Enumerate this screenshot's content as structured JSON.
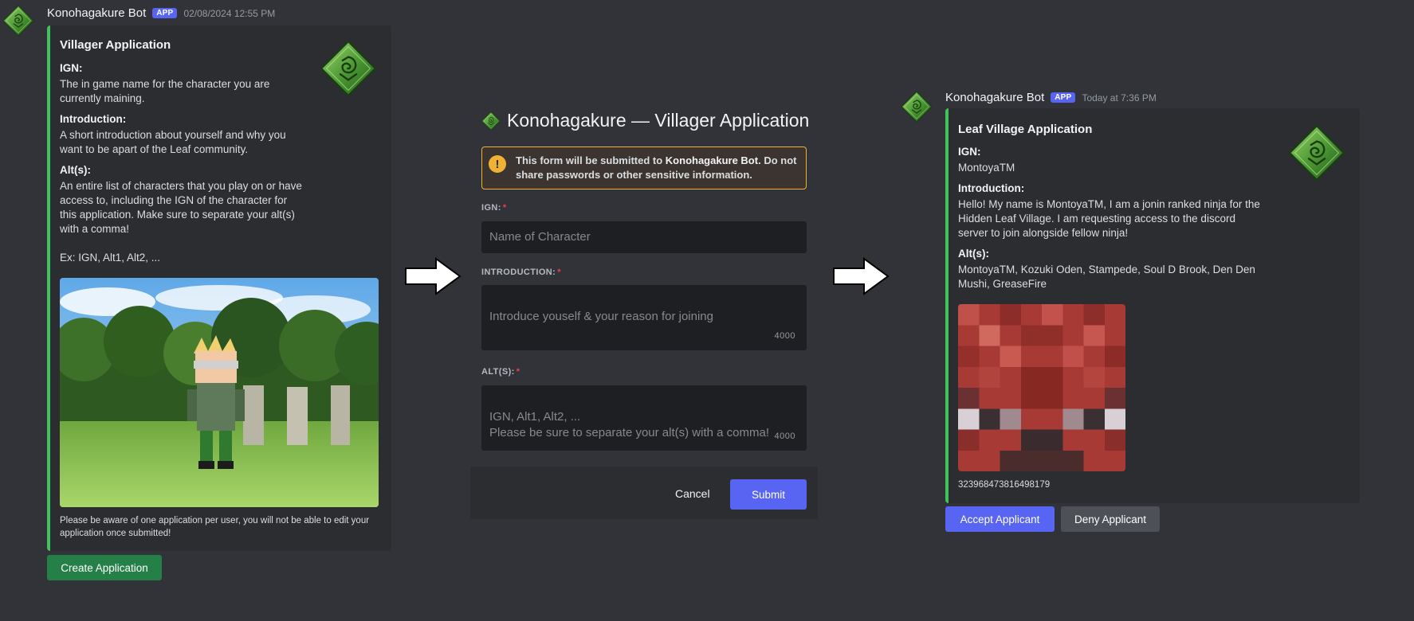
{
  "left_message": {
    "bot_name": "Konohagakure Bot",
    "badge": "APP",
    "timestamp": "02/08/2024 12:55 PM",
    "embed": {
      "title": "Villager Application",
      "fields": [
        {
          "name": "IGN:",
          "value": "The in game name for the character you are\ncurrently maining."
        },
        {
          "name": "Introduction:",
          "value": "A short introduction about yourself and why you\nwant to be apart of the Leaf community."
        },
        {
          "name": "Alt(s):",
          "value": "An entire list of characters that you play on or have\naccess to, including the IGN of the character for\nthis application. Make sure to separate your alt(s)\nwith a comma!\n\nEx: IGN, Alt1, Alt2, ..."
        }
      ],
      "footer": "Please be aware of one application per user, you will not be able to edit your\napplication once submitted!"
    },
    "button_label": "Create Application"
  },
  "modal": {
    "title": "Konohagakure — Villager Application",
    "warning_prefix": "This form will be submitted to ",
    "warning_bold": "Konohagakure Bot",
    "warning_suffix": ". Do not share passwords or other sensitive information.",
    "fields": [
      {
        "label": "IGN:",
        "placeholder": "Name of Character"
      },
      {
        "label": "INTRODUCTION:",
        "placeholder": "Introduce youself & your reason for joining",
        "counter": "4000"
      },
      {
        "label": "ALT(S):",
        "placeholder": "IGN, Alt1, Alt2, ...\nPlease be sure to separate your alt(s) with a comma!",
        "counter": "4000"
      }
    ],
    "required_mark": "*",
    "cancel_label": "Cancel",
    "submit_label": "Submit"
  },
  "right_message": {
    "bot_name": "Konohagakure Bot",
    "badge": "APP",
    "timestamp": "Today at 7:36 PM",
    "embed": {
      "title": "Leaf Village Application",
      "fields": [
        {
          "name": "IGN:",
          "value": "MontoyaTM"
        },
        {
          "name": "Introduction:",
          "value": "Hello! My name is MontoyaTM, I am a jonin ranked ninja for the\nHidden Leaf Village. I am requesting access to the discord\nserver to join alongside fellow ninja!"
        },
        {
          "name": "Alt(s):",
          "value": "MontoyaTM, Kozuki Oden, Stampede, Soul D Brook, Den Den\nMushi, GreaseFire"
        }
      ],
      "footer_id": "323968473816498179"
    },
    "accept_label": "Accept Applicant",
    "deny_label": "Deny Applicant"
  },
  "colors": {
    "accent_green": "#3ec45b",
    "blurple": "#5865f2",
    "warning": "#f0b232",
    "background": "#313338"
  },
  "icons": [
    "konoha-leaf-icon",
    "right-arrow-icon",
    "warning-icon"
  ]
}
